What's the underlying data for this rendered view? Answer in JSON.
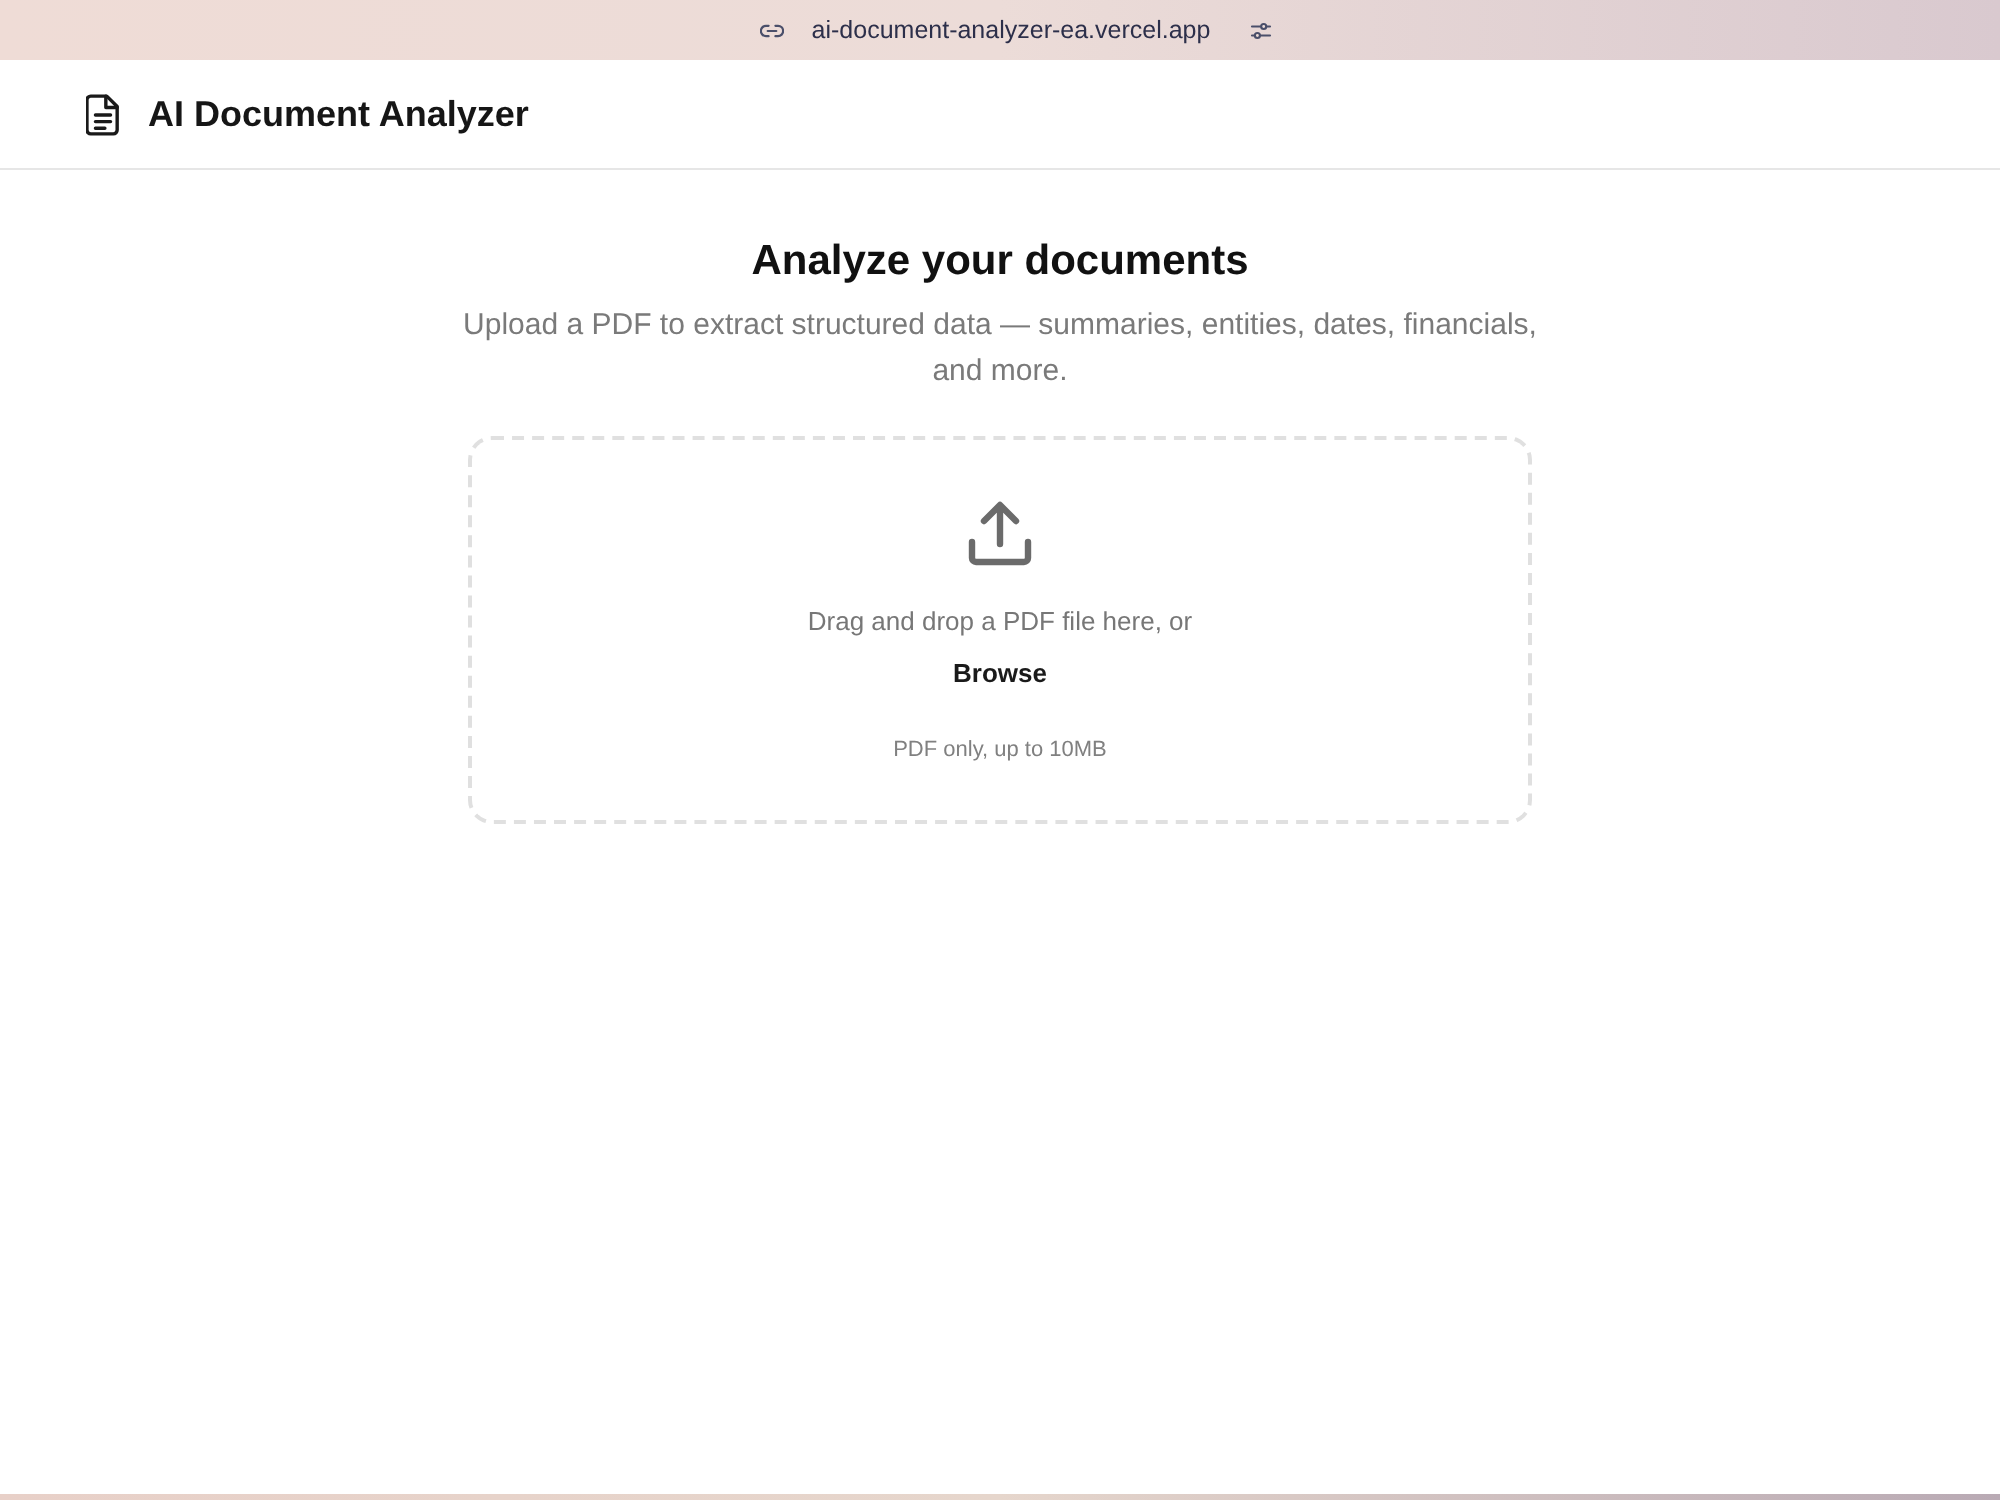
{
  "browser_bar": {
    "url": "ai-document-analyzer-ea.vercel.app"
  },
  "header": {
    "title": "AI Document Analyzer"
  },
  "hero": {
    "title": "Analyze your documents",
    "subtitle": "Upload a PDF to extract structured data — summaries, entities, dates, financials, and more."
  },
  "dropzone": {
    "prompt": "Drag and drop a PDF file here, or",
    "browse_button": "Browse",
    "hint": "PDF only, up to 10MB"
  }
}
